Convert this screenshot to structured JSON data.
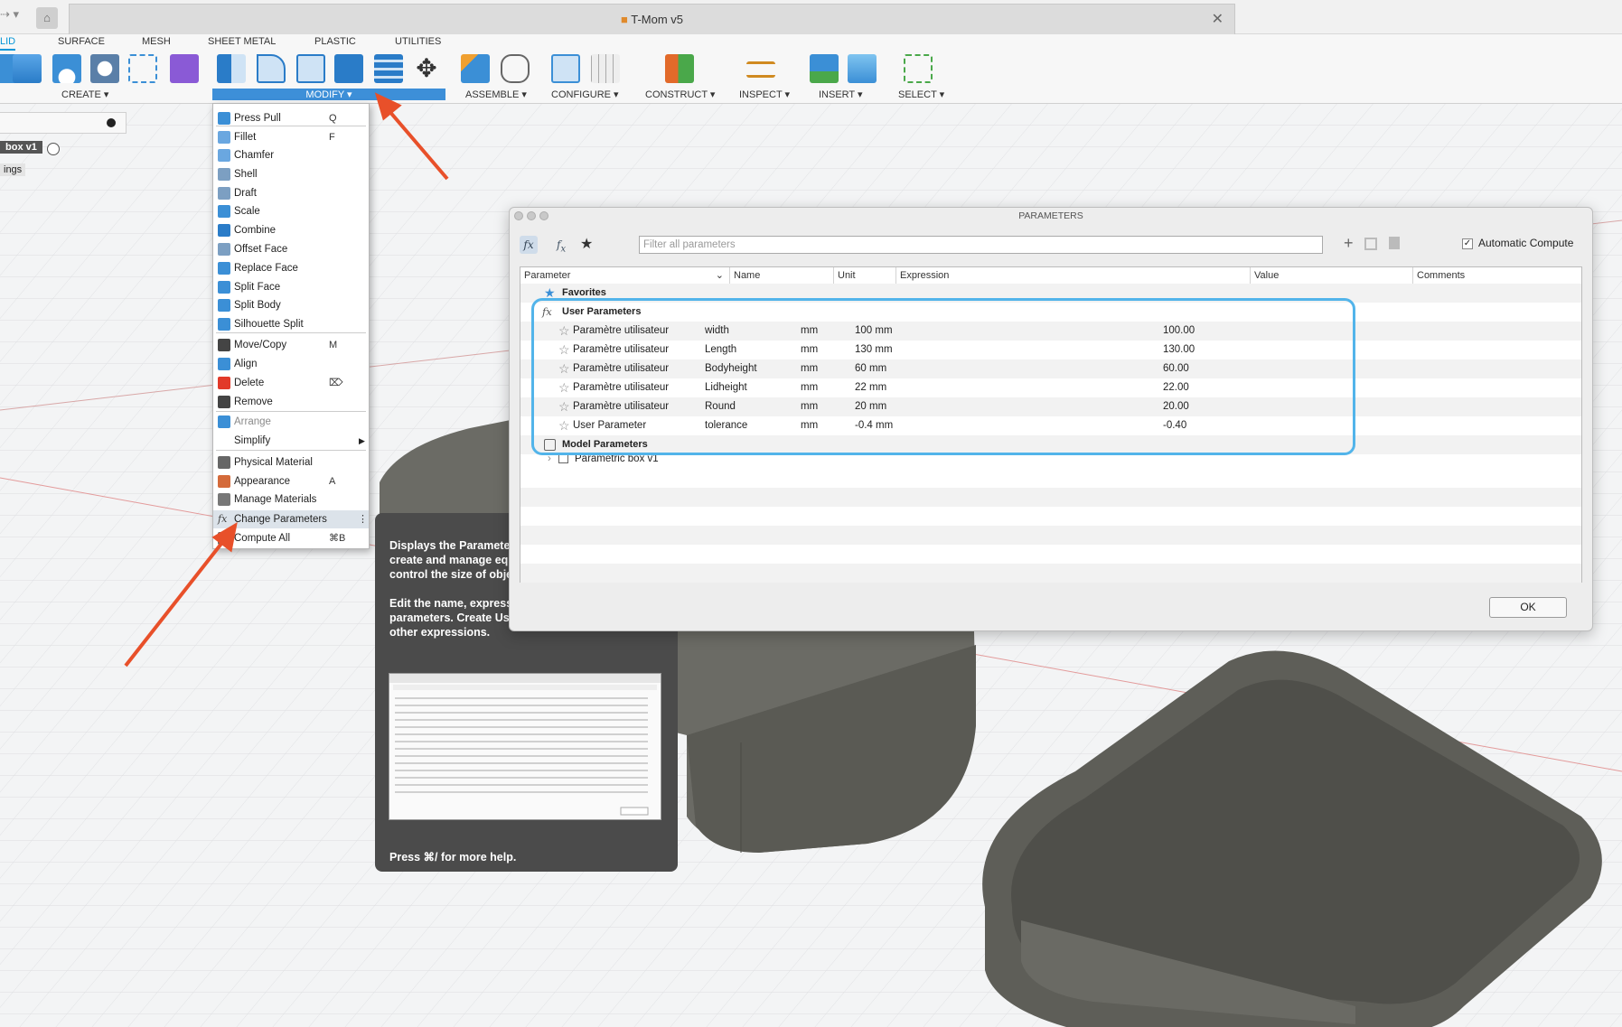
{
  "window": {
    "title": "T-Mom v5",
    "close": "✕"
  },
  "workspace_tabs": [
    "LID",
    "SURFACE",
    "MESH",
    "SHEET METAL",
    "PLASTIC",
    "UTILITIES"
  ],
  "toolbar_groups": {
    "create": "CREATE ▾",
    "modify": "MODIFY ▾",
    "assemble": "ASSEMBLE ▾",
    "configure": "CONFIGURE ▾",
    "construct": "CONSTRUCT ▾",
    "inspect": "INSPECT ▾",
    "insert": "INSERT ▾",
    "select": "SELECT ▾"
  },
  "browser": {
    "item1": "box v1",
    "item2": "ings"
  },
  "modify_menu": [
    {
      "label": "Press Pull",
      "shortcut": "Q",
      "icon": "press-pull-icon"
    },
    {
      "label": "Fillet",
      "shortcut": "F",
      "icon": "fillet-icon"
    },
    {
      "label": "Chamfer",
      "shortcut": "",
      "icon": "chamfer-icon"
    },
    {
      "label": "Shell",
      "shortcut": "",
      "icon": "shell-icon"
    },
    {
      "label": "Draft",
      "shortcut": "",
      "icon": "draft-icon"
    },
    {
      "label": "Scale",
      "shortcut": "",
      "icon": "scale-icon"
    },
    {
      "label": "Combine",
      "shortcut": "",
      "icon": "combine-icon"
    },
    {
      "label": "Offset Face",
      "shortcut": "",
      "icon": "offset-face-icon"
    },
    {
      "label": "Replace Face",
      "shortcut": "",
      "icon": "replace-face-icon"
    },
    {
      "label": "Split Face",
      "shortcut": "",
      "icon": "split-face-icon"
    },
    {
      "label": "Split Body",
      "shortcut": "",
      "icon": "split-body-icon"
    },
    {
      "label": "Silhouette Split",
      "shortcut": "",
      "icon": "silhouette-split-icon"
    },
    {
      "label": "Move/Copy",
      "shortcut": "M",
      "icon": "move-icon"
    },
    {
      "label": "Align",
      "shortcut": "",
      "icon": "align-icon"
    },
    {
      "label": "Delete",
      "shortcut": "⌦",
      "icon": "delete-icon"
    },
    {
      "label": "Remove",
      "shortcut": "",
      "icon": "remove-icon"
    },
    {
      "label": "Arrange",
      "shortcut": "",
      "icon": "arrange-icon"
    },
    {
      "label": "Simplify",
      "shortcut": "",
      "icon": "simplify-icon"
    },
    {
      "label": "Physical Material",
      "shortcut": "",
      "icon": "physical-material-icon"
    },
    {
      "label": "Appearance",
      "shortcut": "A",
      "icon": "appearance-icon"
    },
    {
      "label": "Manage Materials",
      "shortcut": "",
      "icon": "manage-materials-icon"
    },
    {
      "label": "Change Parameters",
      "shortcut": "⋮",
      "icon": "fx-icon"
    },
    {
      "label": "Compute All",
      "shortcut": "⌘B",
      "icon": "compute-icon"
    }
  ],
  "tooltip": {
    "p1": "Displays the Parameters dialog, where you can create and manage equations and relationships to control the size of objects.",
    "p2": "Edit the name, expression, and comments for parameters. Create User Parameters to use in other expressions.",
    "p3": "Press ⌘/ for more help."
  },
  "parameters_dialog": {
    "title": "PARAMETERS",
    "filter_placeholder": "Filter all parameters",
    "auto_compute": "Automatic Compute",
    "auto_compute_checked": true,
    "columns": [
      "Parameter",
      "Name",
      "Unit",
      "Expression",
      "Value",
      "Comments"
    ],
    "favorites": "Favorites",
    "user_group": "User Parameters",
    "rows": [
      {
        "param": "Paramètre utilisateur",
        "name": "width",
        "unit": "mm",
        "expr": "100 mm",
        "value": "100.00"
      },
      {
        "param": "Paramètre utilisateur",
        "name": "Length",
        "unit": "mm",
        "expr": "130 mm",
        "value": "130.00"
      },
      {
        "param": "Paramètre utilisateur",
        "name": "Bodyheight",
        "unit": "mm",
        "expr": "60 mm",
        "value": "60.00"
      },
      {
        "param": "Paramètre utilisateur",
        "name": "Lidheight",
        "unit": "mm",
        "expr": "22 mm",
        "value": "22.00"
      },
      {
        "param": "Paramètre utilisateur",
        "name": "Round",
        "unit": "mm",
        "expr": "20 mm",
        "value": "20.00"
      },
      {
        "param": "User Parameter",
        "name": "tolerance",
        "unit": "mm",
        "expr": "-0.4 mm",
        "value": "-0.40"
      }
    ],
    "model_group": "Model Parameters",
    "model_child": "Parametric box v1",
    "ok": "OK"
  },
  "colors": {
    "accent": "#0696d7",
    "highlight": "#52b4ea",
    "arrow": "#e8502a",
    "body": "#5e5e58"
  }
}
